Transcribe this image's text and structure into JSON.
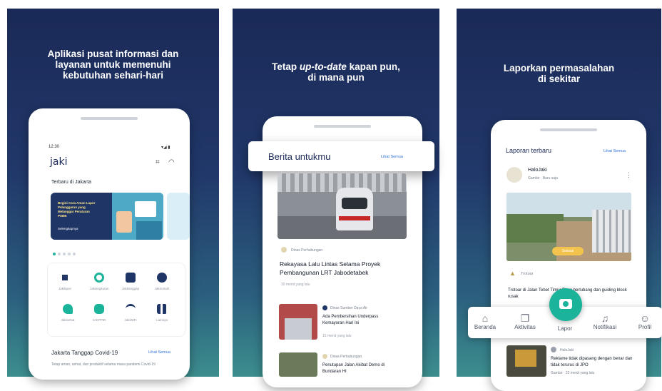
{
  "panel1": {
    "headline": [
      "Aplikasi pusat informasi dan",
      "layanan untuk memenuhi",
      "kebutuhan sehari-hari"
    ],
    "status_time": "12:30",
    "app_logo": "jaki",
    "section_latest": "Terbaru di Jakarta",
    "banner_text": "Begini Cara Aman Lapor Pelanggaran yang Melanggar Peraturan PSBB",
    "banner_button": "Selengkapnya",
    "services": [
      "Jakilapor",
      "Jakiangkutan",
      "Jakitanggap",
      "Jakirumah",
      "Jakisehat",
      "JAKPPID",
      "JakiWiFi",
      "Lainnya"
    ],
    "covid_title": "Jakarta Tanggap Covid-19",
    "covid_link": "Lihat Semua",
    "covid_desc": "Tetap aman, sehat, dan produktif selama masa pandemi Covid-19"
  },
  "panel2": {
    "headline": [
      "Tetap ",
      "up-to-date",
      " kapan pun,",
      "di mana pun"
    ],
    "card_title": "Berita untukmu",
    "card_link": "Lihat Semua",
    "news_main": {
      "source": "Dinas Perhubungan",
      "title": "Rekayasa Lalu Lintas Selama Proyek Pembangunan LRT Jabodetabek",
      "time": "30 menit yang lalu"
    },
    "news": [
      {
        "source": "Dinas Sumber Daya Air",
        "title": "Ada Pembersihan Underpass Kemayoran Hari Ini",
        "time": "15 menit yang lalu"
      },
      {
        "source": "Dinas Perhubungan",
        "title": "Penutupan Jalan Akibat Demo di Bundaran HI",
        "time": ""
      }
    ]
  },
  "panel3": {
    "headline": [
      "Laporkan permasalahan",
      "di sekitar"
    ],
    "section_title": "Laporan terbaru",
    "section_link": "Lihat Semua",
    "report1": {
      "user": "HaloJaki",
      "meta": "Gambir · Baru saja",
      "badge": "Selesai",
      "category": "Trotoar",
      "text": "Trotoar di Jalan Tebet Timur Raya berlubang dan guiding block rusak"
    },
    "report2": {
      "user": "HaloJaki",
      "text": "Reklame tidak dipasang dengan benar dan tidak terurus di JPO",
      "meta": "Gambir · 22 menit yang lalu"
    },
    "nav": [
      "Beranda",
      "Aktivitas",
      "Lapor",
      "Notifikasi",
      "Profil"
    ]
  },
  "colors": {
    "navy": "#1a2957",
    "teal": "#1bb39a",
    "accent": "#2a6fdb"
  }
}
